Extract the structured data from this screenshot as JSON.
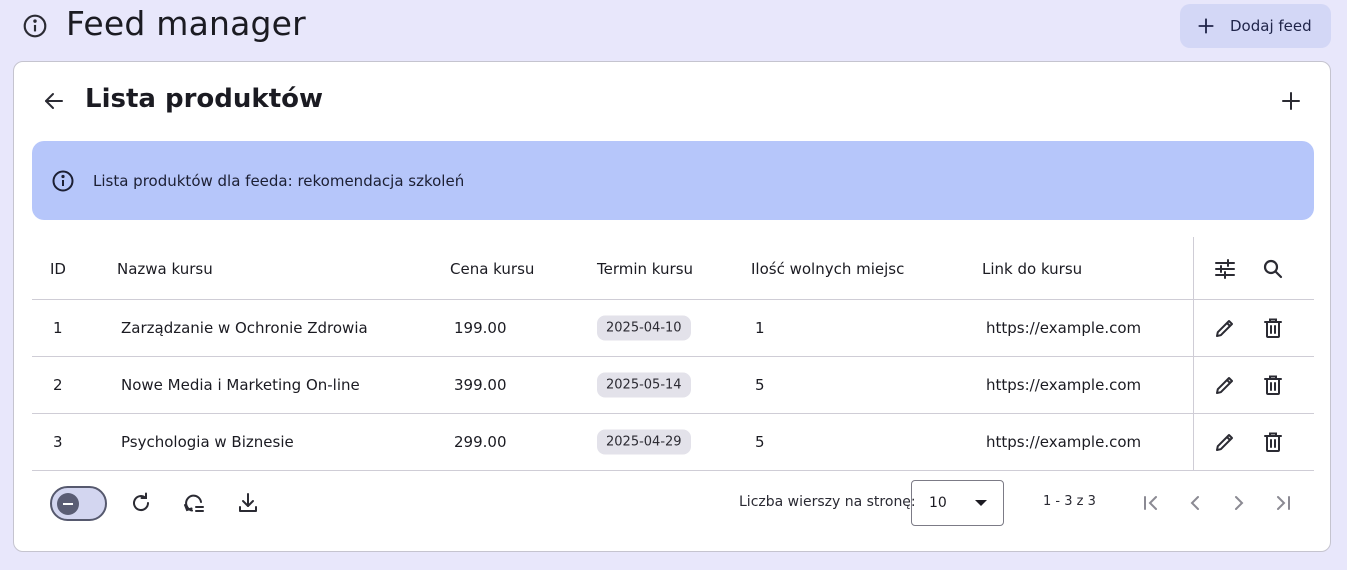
{
  "header": {
    "icon": "info-icon",
    "title": "Feed manager",
    "add_feed_label": "Dodaj feed"
  },
  "card": {
    "title": "Lista produktów",
    "banner_text": "Lista produktów dla feeda: rekomendacja szkoleń"
  },
  "table": {
    "columns": {
      "id": "ID",
      "name": "Nazwa kursu",
      "price": "Cena kursu",
      "date": "Termin kursu",
      "seats": "Ilość wolnych miejsc",
      "link": "Link do kursu"
    },
    "rows": [
      {
        "id": "1",
        "name": "Zarządzanie w Ochronie Zdrowia",
        "price": "199.00",
        "date": "2025-04-10",
        "seats": "1",
        "link": "https://example.com"
      },
      {
        "id": "2",
        "name": "Nowe Media i Marketing On-line",
        "price": "399.00",
        "date": "2025-05-14",
        "seats": "5",
        "link": "https://example.com"
      },
      {
        "id": "3",
        "name": "Psychologia w Biznesie",
        "price": "299.00",
        "date": "2025-04-29",
        "seats": "5",
        "link": "https://example.com"
      }
    ]
  },
  "footer": {
    "rows_per_page_label": "Liczba wierszy na stronę:",
    "rows_per_page_value": "10",
    "range_text": "1 - 3 z 3"
  },
  "colors": {
    "background": "#e8e7fb",
    "banner": "#b6c6fa",
    "primary_button": "#d3d7f6"
  }
}
